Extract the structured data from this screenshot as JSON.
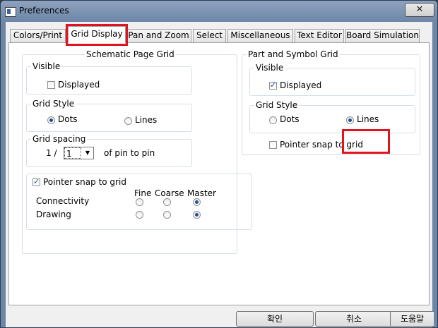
{
  "window": {
    "title": "Preferences",
    "close_glyph": "✕"
  },
  "tabs": [
    {
      "label": "Colors/Print",
      "active": false
    },
    {
      "label": "Grid Display",
      "active": true
    },
    {
      "label": "Pan and Zoom",
      "active": false
    },
    {
      "label": "Select",
      "active": false
    },
    {
      "label": "Miscellaneous",
      "active": false
    },
    {
      "label": "Text Editor",
      "active": false
    },
    {
      "label": "Board Simulation",
      "active": false
    }
  ],
  "schematic": {
    "title": "Schematic Page Grid",
    "visible": {
      "title": "Visible",
      "displayed_label": "Displayed",
      "displayed": false
    },
    "grid_style": {
      "title": "Grid Style",
      "dots_label": "Dots",
      "lines_label": "Lines",
      "selected": "Dots"
    },
    "grid_spacing": {
      "title": "Grid spacing",
      "prefix": "1 /",
      "value": "1",
      "suffix": "of pin to pin"
    },
    "pointer_snap": {
      "label": "Pointer snap to grid",
      "checked": true,
      "columns": [
        "Fine",
        "Coarse",
        "Master"
      ],
      "rows": [
        {
          "label": "Connectivity",
          "selected": "Master"
        },
        {
          "label": "Drawing",
          "selected": "Master"
        }
      ]
    }
  },
  "part_symbol": {
    "title": "Part and Symbol Grid",
    "visible": {
      "title": "Visible",
      "displayed_label": "Displayed",
      "displayed": true
    },
    "grid_style": {
      "title": "Grid Style",
      "dots_label": "Dots",
      "lines_label": "Lines",
      "selected": "Lines"
    },
    "pointer_snap": {
      "label": "Pointer snap to grid",
      "checked": false
    }
  },
  "buttons": {
    "ok": "확인",
    "cancel": "취소",
    "help": "도움말"
  },
  "colors": {
    "highlight": "#e0141e",
    "radio_dot": "#1e4f95"
  }
}
